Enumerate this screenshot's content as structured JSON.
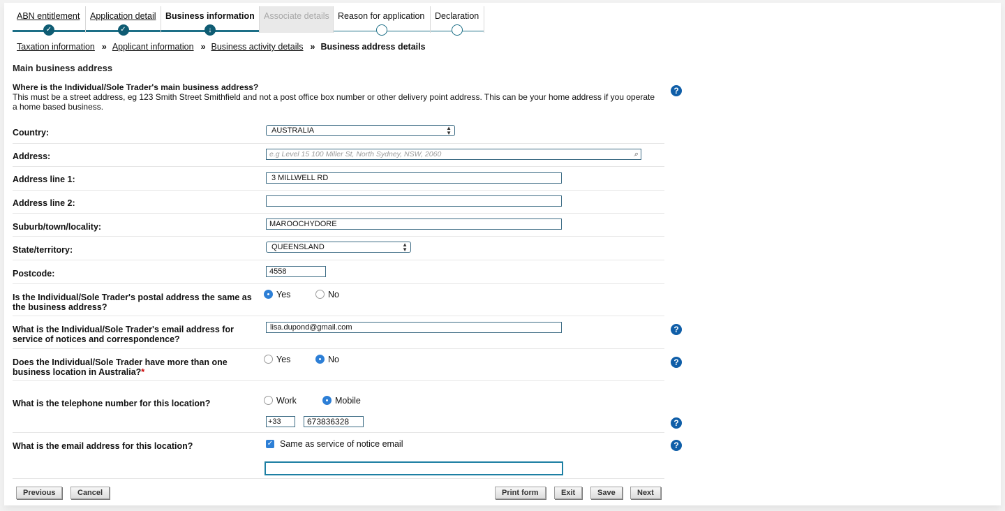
{
  "tabs": [
    {
      "label": "ABN entitlement",
      "state": "done"
    },
    {
      "label": "Application detail",
      "state": "done"
    },
    {
      "label": "Business information",
      "state": "current"
    },
    {
      "label": "Associate details",
      "state": "disabled"
    },
    {
      "label": "Reason for application",
      "state": "future"
    },
    {
      "label": "Declaration",
      "state": "future"
    }
  ],
  "breadcrumb": {
    "items": [
      "Taxation information",
      "Applicant information",
      "Business activity details"
    ],
    "current": "Business address details",
    "separator": "»"
  },
  "section_title": "Main business address",
  "intro": {
    "question": "Where is the Individual/Sole Trader's main business address?",
    "help": "This must be a street address, eg 123 Smith Street Smithfield and not a post office box number or other delivery point address. This can be your home address if you operate a home based business."
  },
  "form": {
    "country": {
      "label": "Country:",
      "value": "AUSTRALIA"
    },
    "address": {
      "label": "Address:",
      "placeholder": "e.g Level 15 100 Miller St, North Sydney, NSW, 2060"
    },
    "address_line1": {
      "label": "Address line 1:",
      "value": "3 MILLWELL RD"
    },
    "address_line2": {
      "label": "Address line 2:",
      "value": ""
    },
    "suburb": {
      "label": "Suburb/town/locality:",
      "value": "MAROOCHYDORE"
    },
    "state": {
      "label": "State/territory:",
      "value": "QUEENSLAND"
    },
    "postcode": {
      "label": "Postcode:",
      "value": "4558"
    },
    "postal_same": {
      "label": "Is the Individual/Sole Trader's postal address the same as the business address?",
      "yes": "Yes",
      "no": "No",
      "selected": "Yes"
    },
    "email": {
      "label": "What is the Individual/Sole Trader's email address for service of notices and correspondence?",
      "value": "lisa.dupond@gmail.com"
    },
    "more_locations": {
      "label": "Does the Individual/Sole Trader have more than one business location in Australia?",
      "required_mark": "*",
      "yes": "Yes",
      "no": "No",
      "selected": "No"
    },
    "phone": {
      "label": "What is the telephone number for this location?",
      "work": "Work",
      "mobile": "Mobile",
      "selected": "Mobile",
      "code": "+33",
      "number": "673836328"
    },
    "location_email": {
      "label": "What is the email address for this location?",
      "checkbox_label": "Same as service of notice email",
      "checked": true,
      "value": ""
    }
  },
  "buttons": {
    "previous": "Previous",
    "cancel": "Cancel",
    "print": "Print form",
    "exit": "Exit",
    "save": "Save",
    "next": "Next"
  },
  "icons": {
    "help": "?",
    "check": "✓",
    "down_arrow": "↓",
    "search": "⌕",
    "select_arrows": "▲▼"
  },
  "colors": {
    "accent": "#1d6f87",
    "help_icon": "#0f5ea8",
    "radio_selected": "#2d7fd6",
    "required": "#cc0000"
  }
}
